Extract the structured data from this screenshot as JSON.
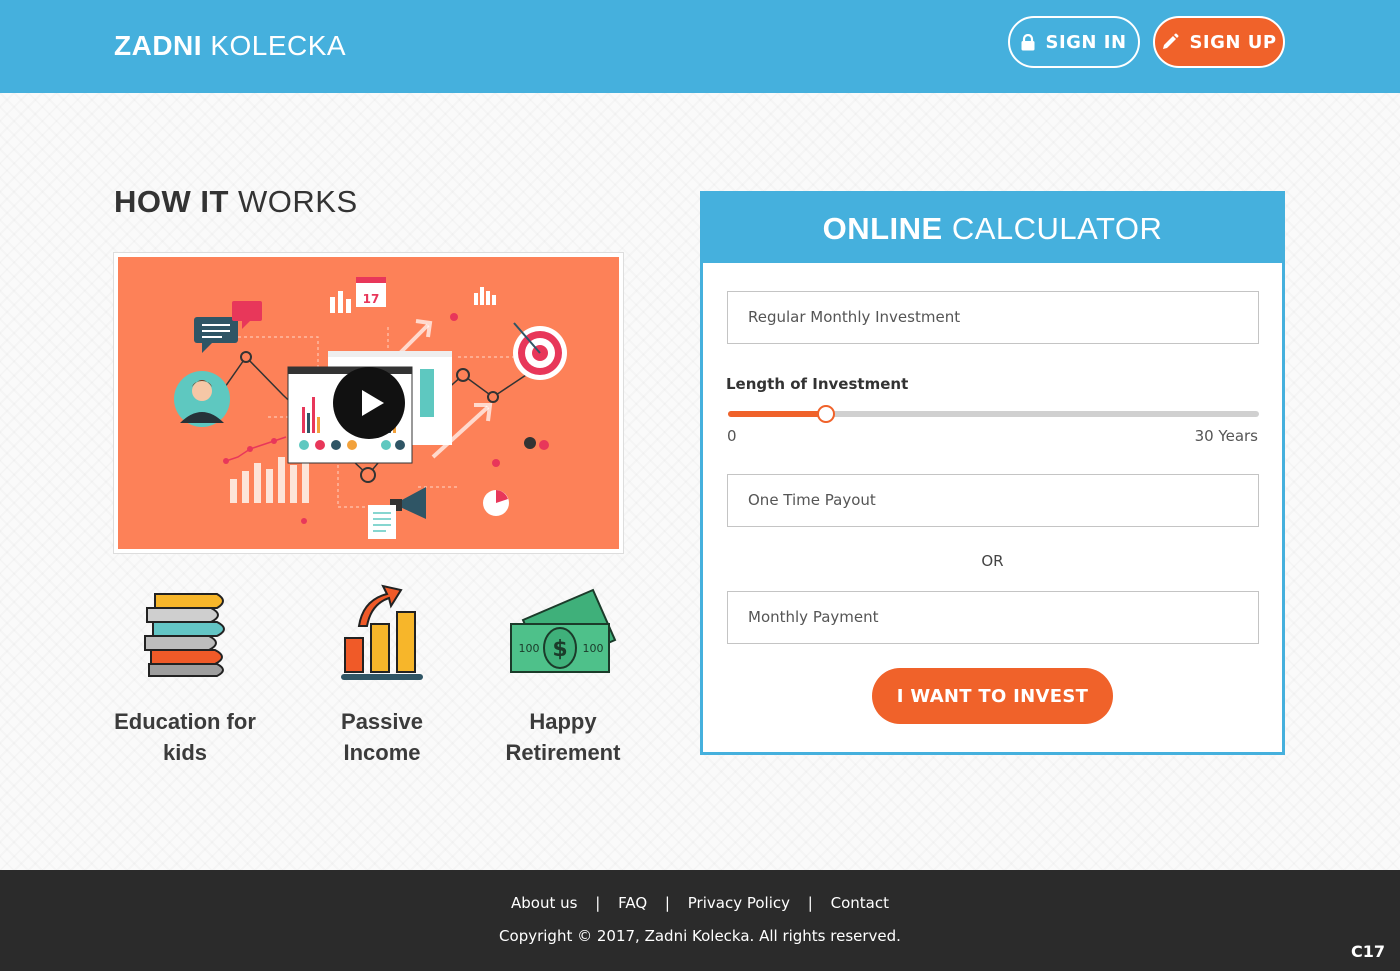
{
  "header": {
    "logo_bold": "ZADNI",
    "logo_light": "KOLECKA",
    "sign_in_label": "SIGN IN",
    "sign_up_label": "SIGN UP"
  },
  "how_it_works": {
    "title_bold": "HOW IT",
    "title_light": "WORKS",
    "video_calendar_day": "17",
    "features": [
      {
        "line1": "Education for",
        "line2": "kids",
        "icon": "books-icon"
      },
      {
        "line1": "Passive",
        "line2": "Income",
        "icon": "growth-chart-icon"
      },
      {
        "line1": "Happy",
        "line2": "Retirement",
        "icon": "money-icon"
      }
    ]
  },
  "calculator": {
    "title_bold": "ONLINE",
    "title_light": "CALCULATOR",
    "monthly_investment_placeholder": "Regular Monthly Investment",
    "length_label": "Length of Investment",
    "slider_min_label": "0",
    "slider_max_label": "30 Years",
    "slider_value_fraction": 0.185,
    "one_time_payout_placeholder": "One Time Payout",
    "or_text": "OR",
    "monthly_payment_placeholder": "Monthly Payment",
    "invest_button_label": "I WANT TO INVEST"
  },
  "footer": {
    "links": [
      "About us",
      "FAQ",
      "Privacy Policy",
      "Contact"
    ],
    "separator": "|",
    "copyright": "Copyright © 2017, Zadni Kolecka. All rights reserved.",
    "corner_code": "C17"
  },
  "colors": {
    "header_blue": "#45b0dd",
    "accent_orange": "#f0622a",
    "video_bg": "#fd8158",
    "footer_dark": "#2b2b2b"
  }
}
